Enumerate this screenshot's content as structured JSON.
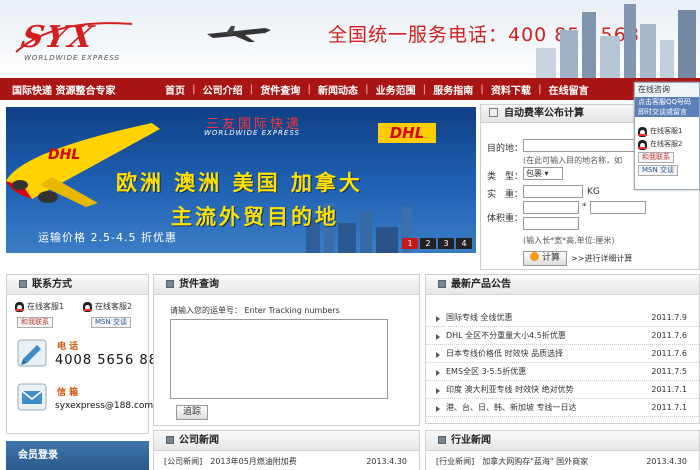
{
  "header": {
    "logo_text": "SYX",
    "logo_sub": "WORLDWIDE EXPRESS",
    "hotline": "全国统一服务电话：400 856 5688"
  },
  "nav": {
    "slogan": "国际快递 资源整合专家",
    "items": [
      "首页",
      "公司介绍",
      "货件查询",
      "新闻动态",
      "业务范围",
      "服务指南",
      "资料下载",
      "在线留言"
    ]
  },
  "banner": {
    "cn_title": "三友国际快递",
    "en_title": "WORLDWIDE EXPRESS",
    "partner": "DHL",
    "line1": "欧洲 澳洲 美国 加拿大",
    "line2": "主流外贸目的地",
    "price": "运输价格 2.5-4.5 折优惠",
    "slides": [
      "1",
      "2",
      "3",
      "4"
    ],
    "active_slide": 1
  },
  "calculator": {
    "title": "自动费率公布计算",
    "dest_label": "目的地：",
    "dest_hint": "(在此可输入目的地名称，如",
    "type_label": "类　型：",
    "type_value": "包裹",
    "weight_label": "实　重：",
    "weight_unit": "KG",
    "volume_label": "体积重：",
    "volume_hint": "(输入长*宽*高,单位:厘米)",
    "calc_button": "计算",
    "detail_link": ">>进行详细计算"
  },
  "consult": {
    "title": "在线咨询",
    "tip_line1": "点击客服QQ号码",
    "tip_line2": "即时交谈或留言",
    "rows": [
      "在线客服1",
      "在线客服2",
      "和我联系",
      "MSN 交谈"
    ]
  },
  "contact": {
    "title": "联系方式",
    "kf1": "在线客服1",
    "kf2": "在线客服2",
    "qq_label": "和我联系",
    "msn_label": "MSN 交谈",
    "phone_label": "电 话",
    "phone_value": "4008 5656 88",
    "mail_label": "信 箱",
    "mail_value": "syxexpress@188.com"
  },
  "member": {
    "title": "会员登录"
  },
  "tracking": {
    "title": "货件查询",
    "label": "请输入您的运单号： Enter Tracking numbers",
    "button": "追踪"
  },
  "products": {
    "title": "最新产品公告",
    "items": [
      {
        "title": "国际专线 全线优惠",
        "date": "2011.7.9"
      },
      {
        "title": "DHL 全区不分重量大小4.5折优惠",
        "date": "2011.7.6"
      },
      {
        "title": "日本专线价格低 时效快 品质选择",
        "date": "2011.7.6"
      },
      {
        "title": "EMS全区 3-5.5折优惠",
        "date": "2011.7.5"
      },
      {
        "title": "印度 澳大利亚专线 时效快 绝对优势",
        "date": "2011.7.1"
      },
      {
        "title": "港、台、日、韩、新加坡 专线一日达",
        "date": "2011.7.1"
      }
    ]
  },
  "company_news": {
    "title": "公司新闻",
    "items": [
      {
        "title": "[公司新闻]　2013年05月燃油附加费",
        "date": "2013.4.30"
      }
    ]
  },
  "industry_news": {
    "title": "行业新闻",
    "items": [
      {
        "title": "[行业新闻]　加拿大网购存\"蓝海\" 国外商家",
        "date": "2013.4.30"
      }
    ]
  },
  "colors": {
    "brand_red": "#a91414",
    "accent_orange": "#d35400",
    "banner_yellow": "#ffe000",
    "member_blue": "#2a5a8c"
  }
}
